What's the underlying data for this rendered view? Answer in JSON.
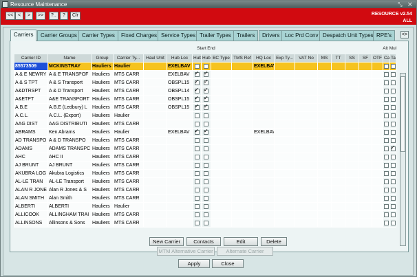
{
  "window": {
    "title": "Resource Maintenance",
    "controls": "⤡ ✕"
  },
  "toolbar": {
    "buttons": [
      {
        "label": "<<",
        "icon": "first-icon"
      },
      {
        "label": "<",
        "icon": "prev-icon"
      },
      {
        "label": ">",
        "icon": "next-icon"
      },
      {
        "label": ">>",
        "icon": "last-icon"
      },
      {
        "label": "?..",
        "icon": "query-icon"
      },
      {
        "label": "?",
        "icon": "help-icon"
      },
      {
        "label": "Clr",
        "icon": "clear-icon"
      }
    ],
    "app_version": "RESOURCE v2.54",
    "scope": "ALL"
  },
  "tabs": [
    "Carriers",
    "Carrier Groups",
    "Carrier Types",
    "Fixed Charges",
    "Service Types",
    "Trailer Types",
    "Trailers",
    "Drivers",
    "Loc Prd Conv",
    "Despatch Unit Types",
    "RPE's"
  ],
  "active_tab": "Carriers",
  "tab_scroll_label": "<>",
  "table": {
    "header_top": {
      "start_hub": "Start",
      "end_hub": "End",
      "alt_car": "Alt",
      "mul_tar": "Mul"
    },
    "columns": [
      "Carrier ID",
      "Name",
      "Group",
      "Carrier Ty...",
      "Haul Unit",
      "Hub Loc",
      "Hub",
      "Hub",
      "BC Type",
      "TMS Ref",
      "HQ Loc",
      "Exp Ty...",
      "VAT No",
      "MS",
      "TT",
      "SS",
      "SF",
      "OTF",
      "Car",
      "Tar"
    ],
    "rows": [
      {
        "id": "85573509",
        "name": "MCKINSTRAY",
        "group": "Hauliers",
        "type": "Haulier",
        "haul": "",
        "hubloc": "EXELBAV",
        "start": false,
        "end": false,
        "hq": "EXELBAV",
        "alt": false,
        "mul": false,
        "selected": true
      },
      {
        "id": "A & E NEWRY",
        "name": "A & E TRANSPOF",
        "group": "Hauliers",
        "type": "MTS CARR",
        "haul": "",
        "hubloc": "EXELBAV",
        "start": true,
        "end": true,
        "hq": "",
        "alt": false,
        "mul": false
      },
      {
        "id": "A & S TPT",
        "name": "A & S Transport",
        "group": "Hauliers",
        "type": "MTS CARR",
        "haul": "",
        "hubloc": "OBSPL15",
        "start": true,
        "end": true,
        "hq": "",
        "alt": false,
        "mul": false
      },
      {
        "id": "A&DTRSPT",
        "name": "A & D Transport",
        "group": "Hauliers",
        "type": "MTS CARR",
        "haul": "",
        "hubloc": "OBSPL14",
        "start": true,
        "end": true,
        "hq": "",
        "alt": false,
        "mul": false
      },
      {
        "id": "A&ETPT",
        "name": "A&E TRANSPORT",
        "group": "Hauliers",
        "type": "MTS CARR",
        "haul": "",
        "hubloc": "OBSPL15",
        "start": true,
        "end": true,
        "hq": "",
        "alt": false,
        "mul": false
      },
      {
        "id": "A.B.E",
        "name": "A.B.E (Ledbury) L",
        "group": "Hauliers",
        "type": "MTS CARR",
        "haul": "",
        "hubloc": "OBSPL15",
        "start": true,
        "end": true,
        "hq": "",
        "alt": false,
        "mul": false
      },
      {
        "id": "A.C.L.",
        "name": "A.C.L. (Export)",
        "group": "Hauliers",
        "type": "Haulier",
        "haul": "",
        "hubloc": "",
        "start": false,
        "end": false,
        "hq": "",
        "alt": false,
        "mul": false
      },
      {
        "id": "AAG DIST",
        "name": "AAG DISTRIBUTI",
        "group": "Hauliers",
        "type": "MTS CARR",
        "haul": "",
        "hubloc": "",
        "start": false,
        "end": false,
        "hq": "",
        "alt": false,
        "mul": false
      },
      {
        "id": "ABRAMS",
        "name": "Ken Abrams",
        "group": "Hauliers",
        "type": "Haulier",
        "haul": "",
        "hubloc": "EXELBAV",
        "start": true,
        "end": true,
        "hq": "EXELBAV",
        "alt": false,
        "mul": false
      },
      {
        "id": "AD TRANSPO",
        "name": "A & D TRANSPO",
        "group": "Hauliers",
        "type": "MTS CARR",
        "haul": "",
        "hubloc": "",
        "start": false,
        "end": false,
        "hq": "",
        "alt": false,
        "mul": false
      },
      {
        "id": "ADAMS",
        "name": "ADAMS TRANSPC",
        "group": "Hauliers",
        "type": "MTS CARR",
        "haul": "",
        "hubloc": "",
        "start": false,
        "end": false,
        "hq": "",
        "alt": false,
        "mul": true
      },
      {
        "id": "AHC",
        "name": "AHC II",
        "group": "Hauliers",
        "type": "MTS CARR",
        "haul": "",
        "hubloc": "",
        "start": false,
        "end": false,
        "hq": "",
        "alt": false,
        "mul": false
      },
      {
        "id": "AJ BRUNT",
        "name": "AJ BRUNT",
        "group": "Hauliers",
        "type": "MTS CARR",
        "haul": "",
        "hubloc": "",
        "start": false,
        "end": false,
        "hq": "",
        "alt": false,
        "mul": false
      },
      {
        "id": "AKUBRA LOG",
        "name": "Akubra Logistics",
        "group": "Hauliers",
        "type": "MTS CARR",
        "haul": "",
        "hubloc": "",
        "start": false,
        "end": false,
        "hq": "",
        "alt": false,
        "mul": false
      },
      {
        "id": "AL-LE TRAN",
        "name": "AL-LE Transport",
        "group": "Hauliers",
        "type": "MTS CARR",
        "haul": "",
        "hubloc": "",
        "start": false,
        "end": false,
        "hq": "",
        "alt": false,
        "mul": false
      },
      {
        "id": "ALAN R JONE",
        "name": "Alan R Jones & S",
        "group": "Hauliers",
        "type": "MTS CARR",
        "haul": "",
        "hubloc": "",
        "start": false,
        "end": false,
        "hq": "",
        "alt": false,
        "mul": false
      },
      {
        "id": "ALAN SMITH",
        "name": "Alan Smith",
        "group": "Hauliers",
        "type": "MTS CARR",
        "haul": "",
        "hubloc": "",
        "start": false,
        "end": false,
        "hq": "",
        "alt": false,
        "mul": false
      },
      {
        "id": "ALBERTI",
        "name": "ALBERTI",
        "group": "Hauliers",
        "type": "Haulier",
        "haul": "",
        "hubloc": "",
        "start": false,
        "end": false,
        "hq": "",
        "alt": false,
        "mul": false
      },
      {
        "id": "ALLICOOK",
        "name": "ALLINGHAM TRAI",
        "group": "Hauliers",
        "type": "MTS CARR",
        "haul": "",
        "hubloc": "",
        "start": false,
        "end": false,
        "hq": "",
        "alt": false,
        "mul": false
      },
      {
        "id": "ALLINSONS",
        "name": "Allinsons & Sons",
        "group": "Hauliers",
        "type": "MTS CARR",
        "haul": "",
        "hubloc": "",
        "start": false,
        "end": false,
        "hq": "",
        "alt": false,
        "mul": false
      }
    ]
  },
  "actions": {
    "new_carrier": "New Carrier",
    "contacts": "Contacts",
    "edit": "Edit",
    "delete": "Delete",
    "mtm_alt": "MTM Alternative Carrier",
    "alt_carrier": "Alternate Carrier"
  },
  "footer": {
    "apply": "Apply",
    "close": "Close"
  }
}
